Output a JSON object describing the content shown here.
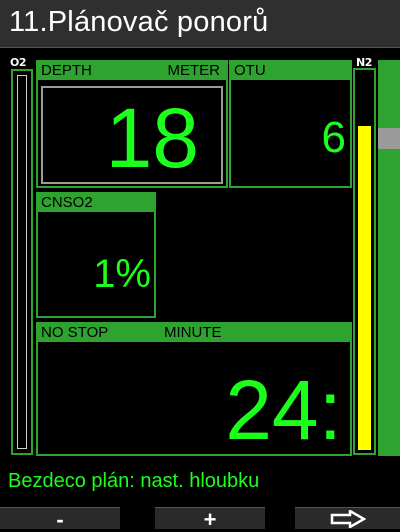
{
  "title": "11.Plánovač ponorů",
  "gauges": {
    "o2_label": "O2",
    "n2_label": "N2",
    "n2_level": 0.86
  },
  "panels": {
    "depth": {
      "label": "DEPTH",
      "unit": "METER",
      "value": "18"
    },
    "otu": {
      "label": "OTU",
      "value": "6"
    },
    "cns": {
      "label": "CNSO2",
      "value": "1%"
    },
    "nostop": {
      "label": "NO STOP",
      "unit": "MINUTE",
      "value": "24:"
    }
  },
  "status": "Bezdeco plán: nast. hloubku",
  "buttons": {
    "minus": "-",
    "plus": "+"
  },
  "icons": {
    "next": "arrow-right-outline-icon"
  },
  "colors": {
    "accent_green": "#2fa32f",
    "value_green": "#1cff1c",
    "n2_yellow": "#ffff00",
    "title_bg": "#2f2f2f"
  }
}
